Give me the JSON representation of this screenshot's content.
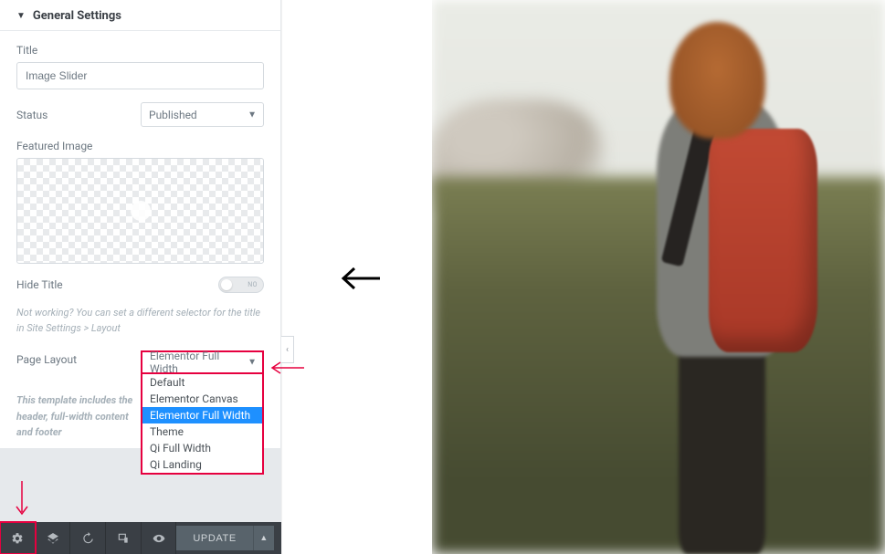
{
  "panel": {
    "title": "General Settings"
  },
  "fields": {
    "title_label": "Title",
    "title_value": "Image Slider",
    "status_label": "Status",
    "status_value": "Published",
    "featured_label": "Featured Image",
    "hide_title_label": "Hide Title",
    "toggle_state": "NO",
    "hint_text": "Not working? You can set a different selector for the title in Site Settings > Layout",
    "layout_label": "Page Layout",
    "layout_value": "Elementor Full Width",
    "template_hint": "This template includes the header, full-width content and footer"
  },
  "layout_options": [
    "Default",
    "Elementor Canvas",
    "Elementor Full Width",
    "Theme",
    "Qi Full Width",
    "Qi Landing"
  ],
  "layout_selected_index": 2,
  "toolbar": {
    "update_label": "UPDATE"
  }
}
